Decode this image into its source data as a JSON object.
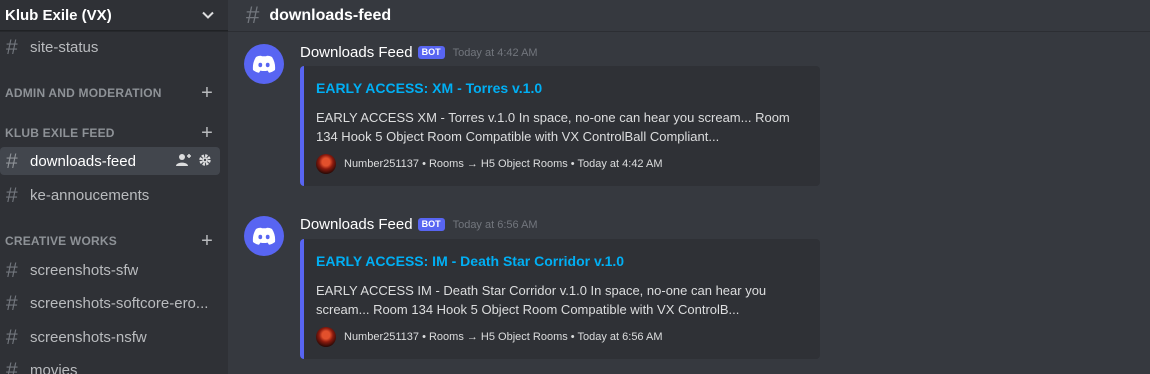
{
  "server": {
    "name": "Klub Exile (VX)"
  },
  "sidebar": {
    "channels_top": [
      {
        "name": "site-status"
      }
    ],
    "categories": [
      {
        "name": "ADMIN AND MODERATION"
      },
      {
        "name": "KLUB EXILE FEED"
      },
      {
        "name": "CREATIVE WORKS"
      }
    ],
    "feed_channels": [
      {
        "name": "downloads-feed"
      },
      {
        "name": "ke-annoucements"
      }
    ],
    "creative_channels": [
      {
        "name": "screenshots-sfw"
      },
      {
        "name": "screenshots-softcore-ero..."
      },
      {
        "name": "screenshots-nsfw"
      },
      {
        "name": "movies"
      }
    ]
  },
  "channel": {
    "title": "downloads-feed"
  },
  "messages": [
    {
      "author": "Downloads Feed",
      "badge": "BOT",
      "timestamp": "Today at 4:42 AM",
      "embed": {
        "title": "EARLY ACCESS: XM - Torres v.1.0",
        "description": "EARLY ACCESS XM - Torres v.1.0 In space, no-one can hear you scream...   Room 134   Hook 5 Object Room   Compatible with VX   ControlBall Compliant...",
        "footer": "Number251137 • Rooms → H5 Object Rooms • Today at 4:42 AM"
      }
    },
    {
      "author": "Downloads Feed",
      "badge": "BOT",
      "timestamp": "Today at 6:56 AM",
      "embed": {
        "title": "EARLY ACCESS: IM - Death Star Corridor v.1.0",
        "description": "EARLY ACCESS IM - Death Star Corridor v.1.0 In space, no-one can hear you scream...   Room 134   Hook 5 Object Room   Compatible with VX   ControlB...",
        "footer": "Number251137 • Rooms → H5 Object Rooms • Today at 6:56 AM"
      }
    }
  ],
  "colors": {
    "accent": "#5865f2",
    "link": "#00aff4",
    "background": "#36393f",
    "sidebar": "#2f3136"
  }
}
